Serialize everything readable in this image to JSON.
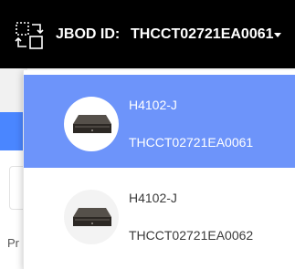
{
  "header": {
    "label": "JBOD ID:",
    "selected_value": "THCCT02721EA0061",
    "switch_icon": "switch-arrows-icon",
    "caret_icon": "caret-down-icon",
    "background_color": "#000000"
  },
  "background_ui": {
    "partial_text": "Pr",
    "accent_color": "#4a86ff"
  },
  "dropdown": {
    "selected_index": 0,
    "selected_color": "#6d94fa",
    "items": [
      {
        "model": "H4102-J",
        "serial": "THCCT02721EA0061",
        "icon": "jbod-device-icon"
      },
      {
        "model": "H4102-J",
        "serial": "THCCT02721EA0062",
        "icon": "jbod-device-icon"
      }
    ]
  }
}
